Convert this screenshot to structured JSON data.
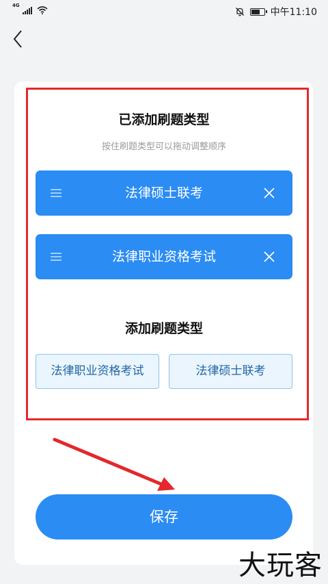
{
  "status_bar": {
    "network": "4G",
    "time": "中午11:10",
    "battery_level": 0.75
  },
  "added_section": {
    "title": "已添加刷题类型",
    "hint": "按住刷题类型可以拖动调整顺序",
    "items": [
      {
        "label": "法律硕士联考"
      },
      {
        "label": "法律职业资格考试"
      }
    ]
  },
  "add_section": {
    "title": "添加刷题类型",
    "options": [
      {
        "label": "法律职业资格考试"
      },
      {
        "label": "法律硕士联考"
      }
    ]
  },
  "save_label": "保存",
  "watermark": "大玩客",
  "colors": {
    "primary": "#2b8cf3",
    "highlight": "#e4282b"
  },
  "icons": [
    "back-arrow-icon",
    "drag-handle-icon",
    "close-icon",
    "signal-icon",
    "wifi-icon",
    "mute-icon",
    "battery-icon"
  ]
}
